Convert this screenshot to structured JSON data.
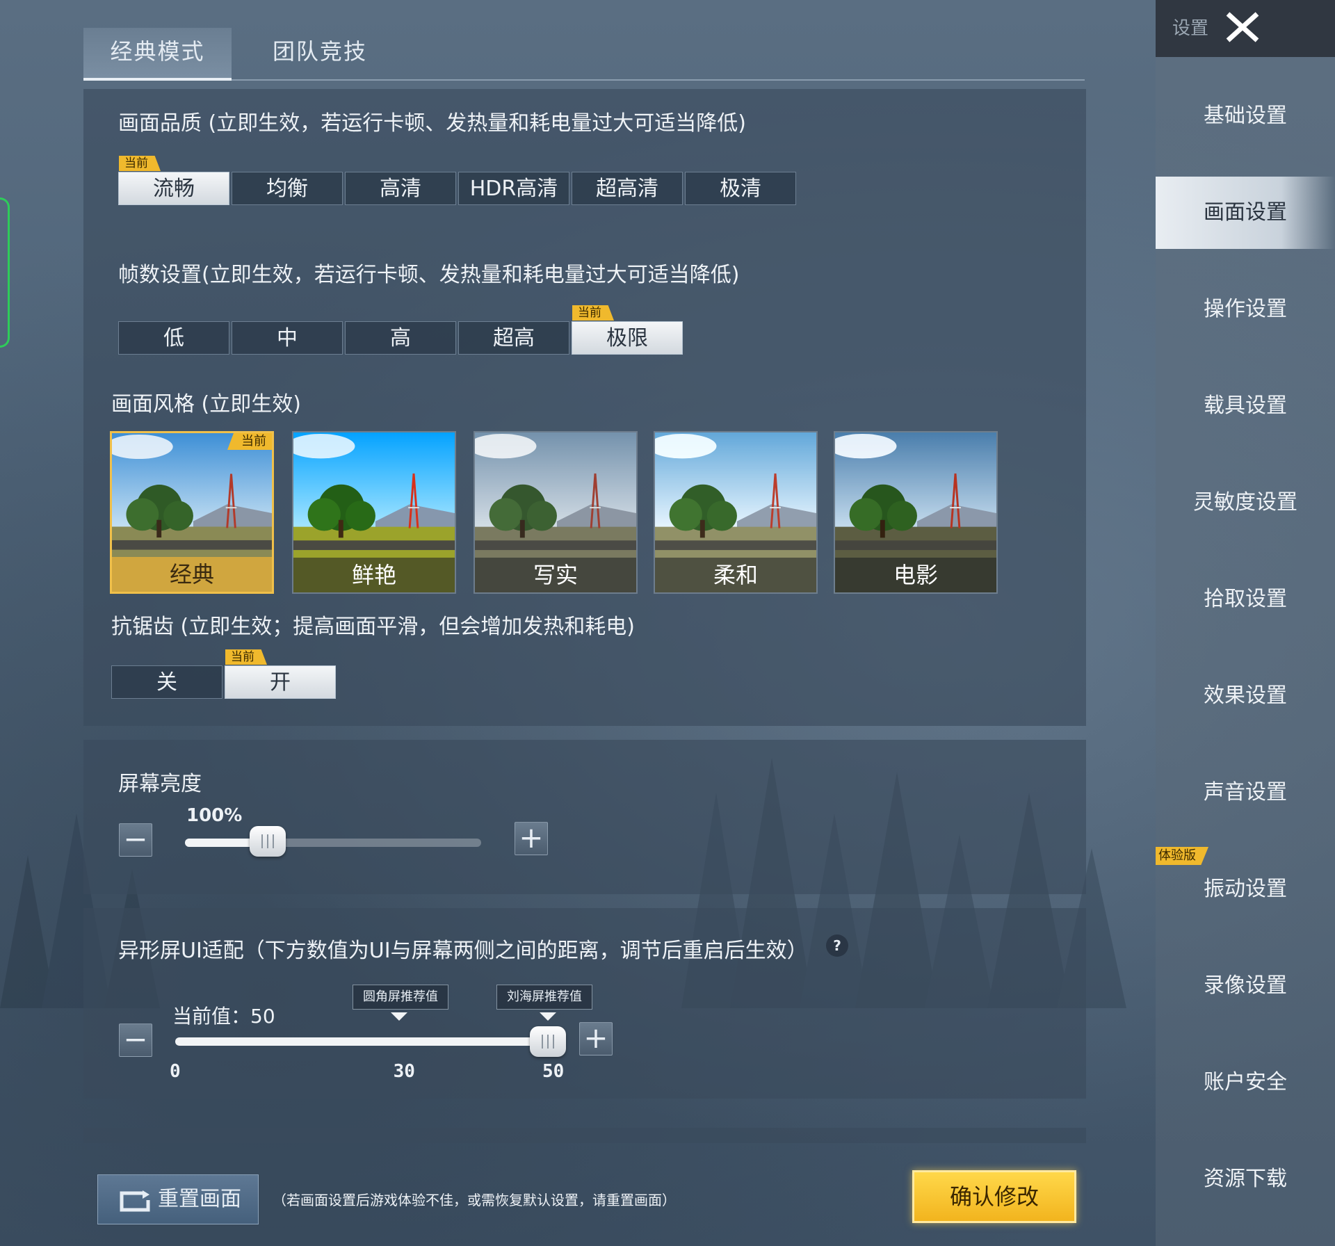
{
  "tabs": [
    {
      "label": "经典模式",
      "active": true
    },
    {
      "label": "团队竞技",
      "active": false
    }
  ],
  "current_badge": "当前",
  "quality": {
    "title": "画面品质 (立即生效，若运行卡顿、发热量和耗电量过大可适当降低)",
    "options": [
      "流畅",
      "均衡",
      "高清",
      "HDR高清",
      "超高清",
      "极清"
    ],
    "selected": "流畅"
  },
  "framerate": {
    "title": "帧数设置(立即生效，若运行卡顿、发热量和耗电量过大可适当降低)",
    "options": [
      "低",
      "中",
      "高",
      "超高",
      "极限"
    ],
    "selected": "极限"
  },
  "style": {
    "title": "画面风格 (立即生效)",
    "options": [
      "经典",
      "鲜艳",
      "写实",
      "柔和",
      "电影"
    ],
    "selected": "经典"
  },
  "antialias": {
    "title": "抗锯齿 (立即生效；提高画面平滑，但会增加发热和耗电)",
    "options": [
      "关",
      "开"
    ],
    "selected": "开"
  },
  "brightness": {
    "title": "屏幕亮度",
    "value_text": "100%",
    "fraction": 0.28,
    "minus": "−",
    "plus": "+"
  },
  "notch": {
    "title": "异形屏UI适配（下方数值为UI与屏幕两侧之间的距离，调节后重启后生效）",
    "help": "?",
    "current_value_text": "当前值：50",
    "value": 50,
    "min": 0,
    "max": 50,
    "ticks": [
      "0",
      "30",
      "50"
    ],
    "hint_rounded": "圆角屏推荐值",
    "hint_notch": "刘海屏推荐值",
    "minus": "−",
    "plus": "+"
  },
  "footer": {
    "reset_label": "重置画面",
    "note": "（若画面设置后游戏体验不佳，或需恢复默认设置，请重置画面）",
    "confirm_label": "确认修改"
  },
  "nav": {
    "header_label": "设置",
    "close": "×",
    "items": [
      "基础设置",
      "画面设置",
      "操作设置",
      "载具设置",
      "灵敏度设置",
      "拾取设置",
      "效果设置",
      "声音设置",
      "振动设置",
      "录像设置",
      "账户安全",
      "资源下载"
    ],
    "active": "画面设置",
    "beta_badge": "体验版"
  },
  "colors": {
    "accent_gold": "#f0b92d",
    "confirm_yellow": "#ffd84a",
    "edge_green": "#2ecc5a"
  }
}
